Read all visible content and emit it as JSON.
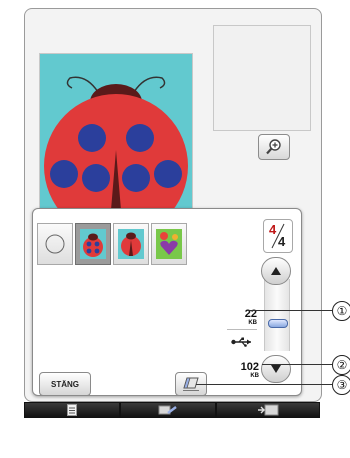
{
  "preview": {
    "image_name": "ladybug-embroidery-design",
    "colors": {
      "background": "#62c9cf",
      "body": "#e03a3a",
      "spots": "#2b3f9c",
      "head": "#5a1a1a"
    }
  },
  "popup": {
    "page_indicator": {
      "current": "4",
      "total": "4"
    },
    "memory": {
      "top": {
        "value": "22",
        "unit": "KB"
      },
      "bottom": {
        "value": "102",
        "unit": "KB"
      }
    },
    "close_label": "STÄNG"
  },
  "callouts": [
    "①",
    "②",
    "③"
  ],
  "icons": {
    "zoom": "magnify-plus-icon",
    "usb": "usb-icon",
    "eraser": "eraser-icon",
    "scroll_up": "triangle-up-icon",
    "scroll_down": "triangle-down-icon",
    "bottom": [
      "document-icon",
      "sewing-icon",
      "machine-icon"
    ]
  },
  "accent_colors": {
    "page_current": "#c01818",
    "scroll_thumb": "#8aa8e0"
  }
}
